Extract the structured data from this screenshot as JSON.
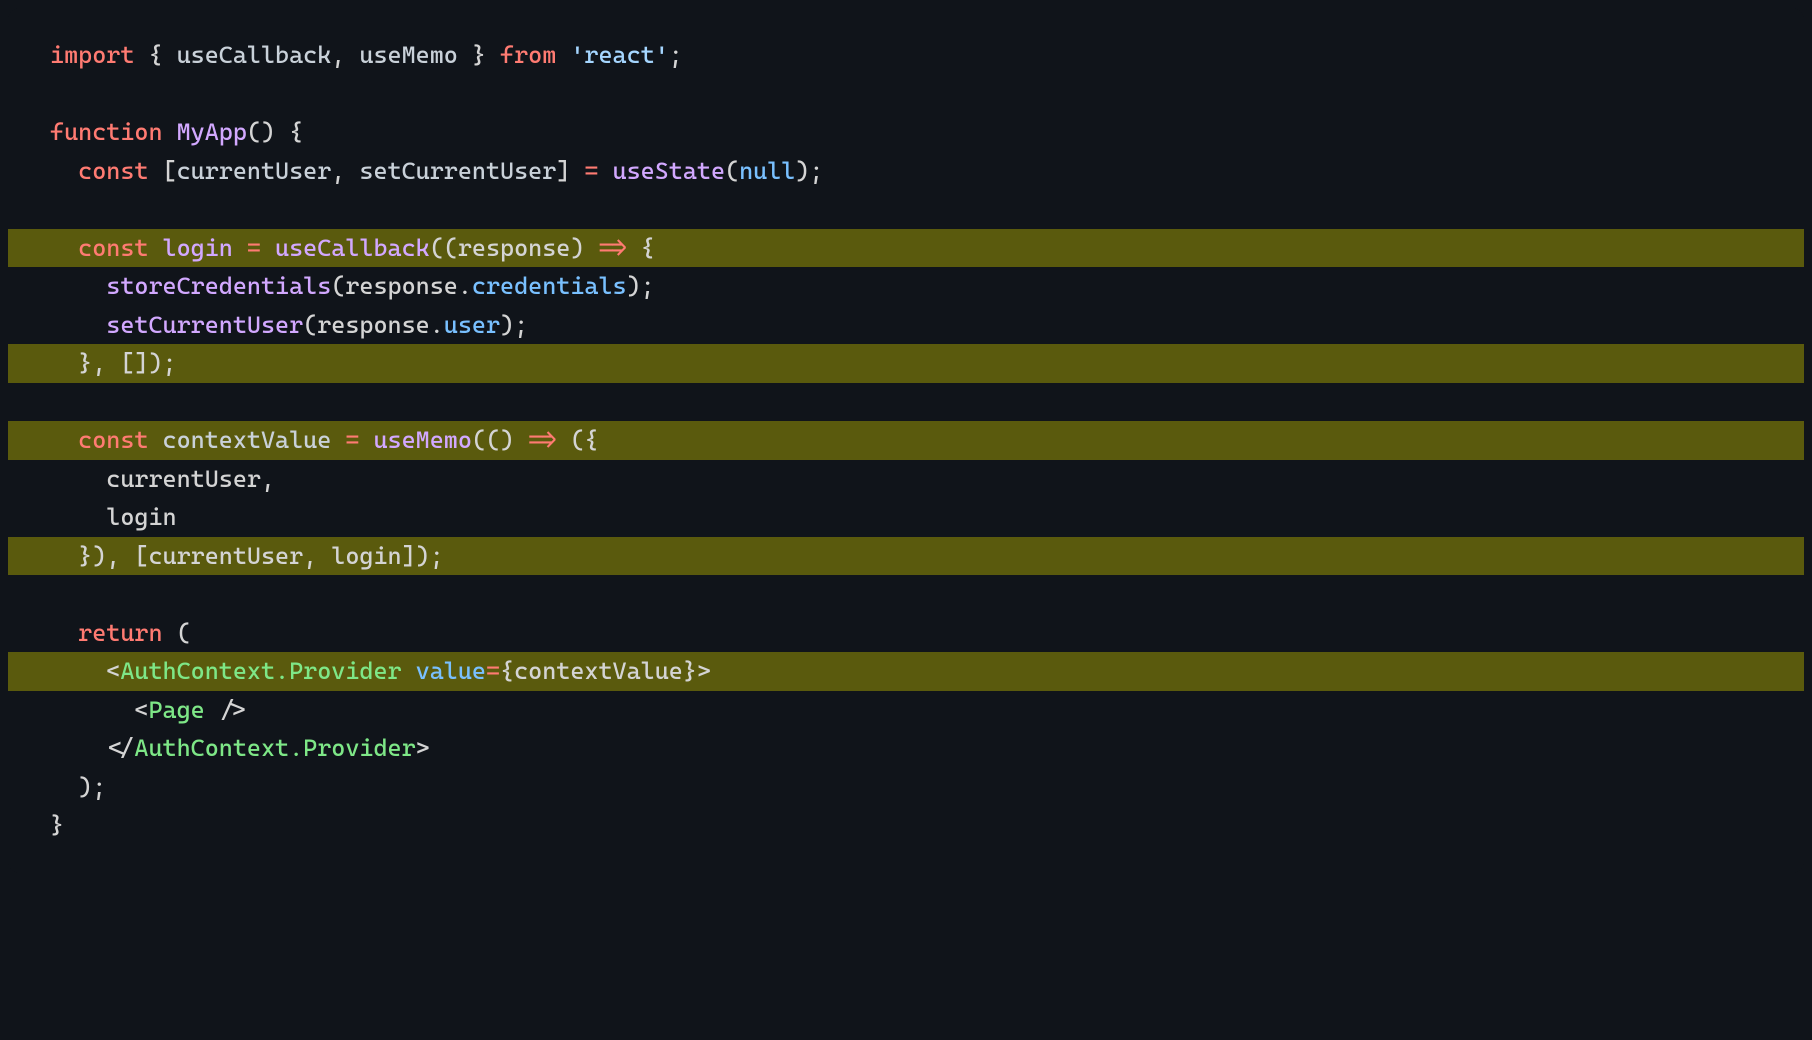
{
  "code": {
    "l1": {
      "import": "import",
      "brace1": " { ",
      "useCallback": "useCallback",
      "comma1": ", ",
      "useMemo": "useMemo",
      "brace2": " } ",
      "from": "from",
      "sp": " ",
      "react": "'react'",
      "semi": ";"
    },
    "l3": {
      "function": "function",
      "sp": " ",
      "name": "MyApp",
      "parens": "() {"
    },
    "l4": {
      "indent": "  ",
      "const": "const",
      "sp": " ",
      "bracket1": "[",
      "currentUser": "currentUser",
      "comma": ", ",
      "setCurrentUser": "setCurrentUser",
      "bracket2": "] ",
      "eq": "=",
      "sp2": " ",
      "useState": "useState",
      "paren1": "(",
      "null": "null",
      "paren2": ");"
    },
    "l6": {
      "indent": "  ",
      "const": "const",
      "sp": " ",
      "login": "login",
      "sp2": " ",
      "eq": "=",
      "sp3": " ",
      "useCallback": "useCallback",
      "rest": "((response) ",
      "arrow": "=>",
      "rest2": " {"
    },
    "l7": {
      "indent": "    ",
      "fn": "storeCredentials",
      "paren1": "(response.",
      "prop": "credentials",
      "paren2": ");"
    },
    "l8": {
      "indent": "    ",
      "fn": "setCurrentUser",
      "paren1": "(response.",
      "prop": "user",
      "paren2": ");"
    },
    "l9": {
      "text": "  }, []);"
    },
    "l11": {
      "indent": "  ",
      "const": "const",
      "sp": " ",
      "var": "contextValue",
      "sp2": " ",
      "eq": "=",
      "sp3": " ",
      "useMemo": "useMemo",
      "rest": "(() ",
      "arrow": "=>",
      "rest2": " ({"
    },
    "l12": {
      "text": "    currentUser,"
    },
    "l13": {
      "text": "    login"
    },
    "l14": {
      "text": "  }), [currentUser, login]);"
    },
    "l16": {
      "indent": "  ",
      "return": "return",
      "rest": " ("
    },
    "l17": {
      "indent": "    ",
      "lt": "<",
      "tag": "AuthContext.Provider",
      "sp": " ",
      "attr": "value",
      "eq": "=",
      "brace1": "{contextValue}",
      "gt": ">"
    },
    "l18": {
      "indent": "      ",
      "lt": "<",
      "tag": "Page",
      "rest": " />"
    },
    "l19": {
      "indent": "    ",
      "lt": "</",
      "tag": "AuthContext.Provider",
      "gt": ">"
    },
    "l20": {
      "text": "  );"
    },
    "l21": {
      "text": "}"
    }
  }
}
